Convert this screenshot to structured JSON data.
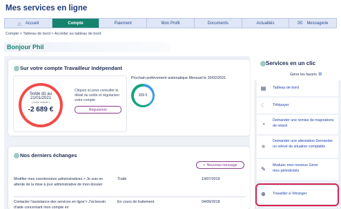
{
  "site_title": "Mes services en ligne",
  "nav": [
    {
      "label": "Accueil",
      "icon": "home-icon"
    },
    {
      "label": "Compte",
      "active": true
    },
    {
      "label": "Paiement"
    },
    {
      "label": "Mon Profil"
    },
    {
      "label": "Documents"
    },
    {
      "label": "Actualités"
    },
    {
      "label": "Messagerie",
      "icon": "mail-icon"
    }
  ],
  "breadcrumb": "Compte > Tableau de bord > Accéder au tableau de bord",
  "greeting": "Bonjour Phil",
  "account": {
    "title": "Sur votre compte Travailleur Indépendant",
    "solde_label": "Solde dû au 21/01/2021",
    "solde_note": "( à titre indicatif )",
    "solde_amount": "-2 689 €",
    "solde_text": "Cliquez ici pour consulter le détail du solde et régulariser votre compte",
    "regulariser_label": "Régulariser",
    "prelev_text": "Prochain prélèvement automatique Mensuel le 20/02/2021",
    "prelev_amount": "209 €"
  },
  "exchanges": {
    "title": "Nos derniers échanges",
    "new_message_label": "Nouveau message",
    "rows": [
      {
        "subject": "Modifier mes coordonnées administratives > Je suis en attente de la mise à jour administrative de mon dossier",
        "status": "Traité",
        "date": "19/07/2019"
      },
      {
        "subject": "Contacter l'assistance des services en ligne'> J'ai besoin d'aide concernant mon compte en",
        "status": "En cours de traitement",
        "date": "04/09/2018"
      }
    ]
  },
  "quick": {
    "title": "Services en un clic",
    "favorites_label": "Gérer les favoris",
    "items": [
      {
        "label": "Tableau de bord",
        "icon": "dashboard-icon"
      },
      {
        "label": "Télépayer",
        "icon": "card-icon"
      },
      {
        "label": "Demander une remise de majorations de retard",
        "icon": "clock-icon"
      },
      {
        "label": "Demander une attestation Demander un relevé de situation comptable",
        "icon": "document-icon"
      },
      {
        "label": "Moduler mes revenus Gérer mes périodicités",
        "icon": "pencil-icon"
      },
      {
        "label": "Travailler à l'étranger",
        "icon": "globe-icon"
      }
    ]
  },
  "colors": {
    "accent": "#16836f",
    "alert": "#f44a47",
    "highlight": "#d42250",
    "link": "#1f3fa8"
  }
}
